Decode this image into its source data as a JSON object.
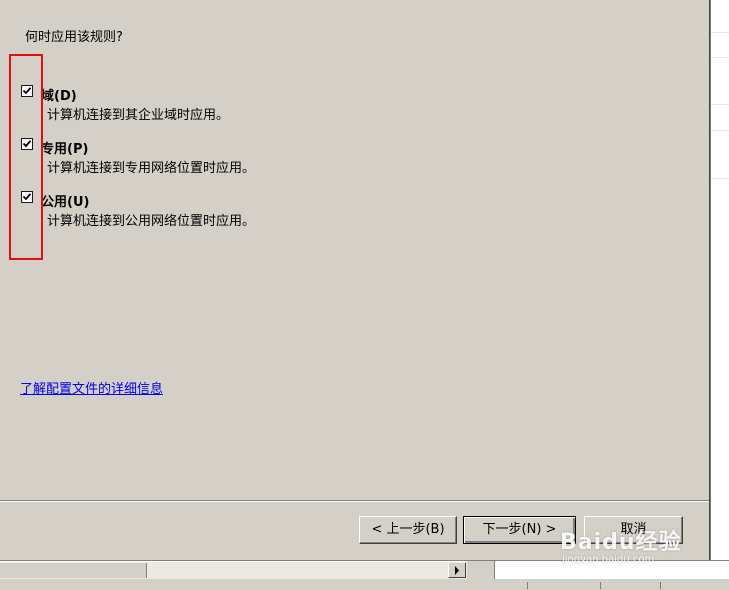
{
  "wizard": {
    "question": "何时应用该规则?",
    "profiles": [
      {
        "label": "域(D)",
        "description": "计算机连接到其企业域时应用。",
        "checked": true
      },
      {
        "label": "专用(P)",
        "description": "计算机连接到专用网络位置时应用。",
        "checked": true
      },
      {
        "label": "公用(U)",
        "description": "计算机连接到公用网络位置时应用。",
        "checked": true
      }
    ],
    "more_info_link": "了解配置文件的详细信息"
  },
  "buttons": {
    "back": "< 上一步(B)",
    "next": "下一步(N) >",
    "cancel": "取消"
  },
  "watermark": {
    "brand": "Baidu经验",
    "sub": "jingyan.baidu.com"
  },
  "colors": {
    "dialog_bg": "#d4d0c8",
    "highlight": "#e01010",
    "link": "#0000ee"
  }
}
